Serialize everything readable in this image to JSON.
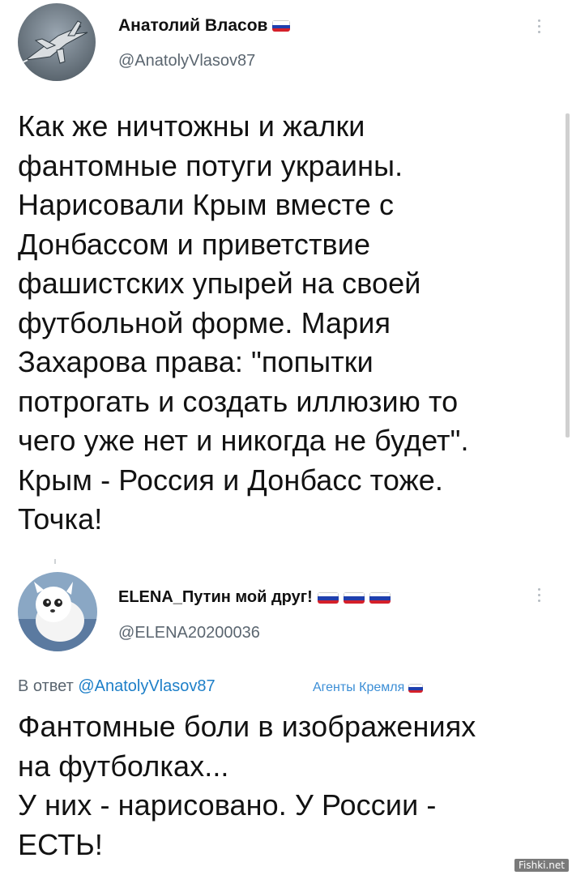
{
  "tweet1": {
    "author_name": "Анатолий Власов",
    "handle": "@AnatolyVlasov87",
    "avatar_icon": "fighter-jet-avatar",
    "lines": [
      "Как же ничтожны и жалки",
      "фантомные потуги украины.",
      "Нарисовали Крым вместе с",
      "Донбассом и приветствие",
      "фашистских упырей на своей",
      "футбольной форме. Мария",
      "Захарова права: \"попытки",
      "потрогать и создать иллюзию то",
      "чего уже нет и никогда не будет\".",
      "Крым - Россия и Донбасс тоже.",
      "Точка!"
    ]
  },
  "tweet2": {
    "author_name": "ELENA_Путин мой друг!",
    "handle": "@ELENA20200036",
    "avatar_icon": "white-dog-avatar",
    "reply_prefix": "В ответ",
    "reply_to": "@AnatolyVlasov87",
    "label": "Агенты Кремля",
    "lines": [
      "Фантомные боли в изображениях",
      "на футболках...",
      "У них - нарисовано. У России -",
      "ЕСТЬ!"
    ]
  },
  "watermark": "Fishki.net",
  "colors": {
    "flag_white": "#ffffff",
    "flag_blue": "#1f3fae",
    "flag_red": "#d4202a",
    "link": "#1d7fc8",
    "muted": "#5b6670"
  }
}
